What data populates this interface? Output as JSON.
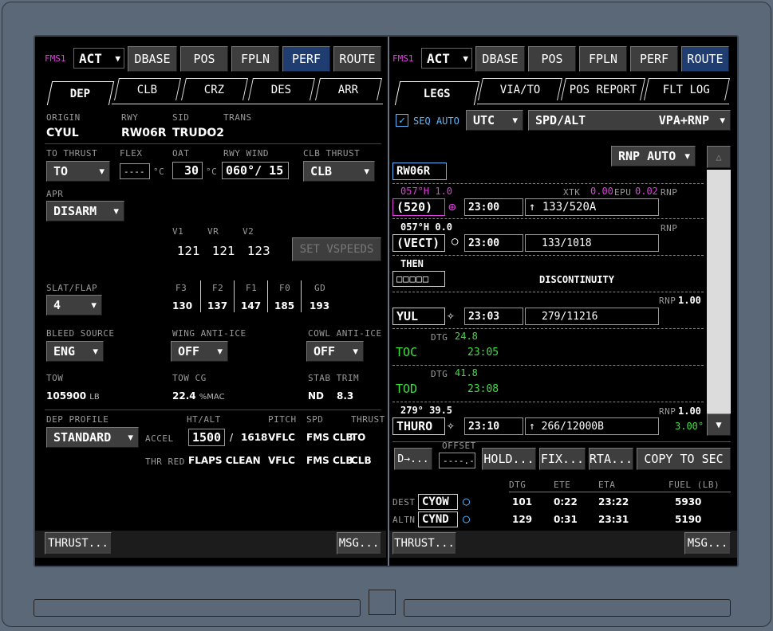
{
  "left": {
    "fms": "FMS1",
    "act": "ACT",
    "tabs_top": [
      "DBASE",
      "POS",
      "FPLN",
      "PERF",
      "ROUTE"
    ],
    "subtabs": [
      "DEP",
      "CLB",
      "CRZ",
      "DES",
      "ARR"
    ],
    "origin_lbl": "ORIGIN",
    "origin": "CYUL",
    "rwy_lbl": "RWY",
    "rwy": "RW06R",
    "sid_lbl": "SID",
    "sid": "TRUDO2",
    "trans_lbl": "TRANS",
    "to_thrust_lbl": "TO THRUST",
    "to_thrust": "TO",
    "flex_lbl": "FLEX",
    "flex": "----",
    "flex_unit": "°C",
    "oat_lbl": "OAT",
    "oat": "30",
    "oat_unit": "°C",
    "rwy_wind_lbl": "RWY WIND",
    "rwy_wind": "060°/ 15",
    "clb_thrust_lbl": "CLB THRUST",
    "clb_thrust": "CLB",
    "apr_lbl": "APR",
    "apr": "DISARM",
    "v1_lbl": "V1",
    "vr_lbl": "VR",
    "v2_lbl": "V2",
    "v1": "121",
    "vr": "121",
    "v2": "123",
    "set_vspeeds": "SET VSPEEDS",
    "slat_flap_lbl": "SLAT/FLAP",
    "slat_flap": "4",
    "f3_lbl": "F3",
    "f2_lbl": "F2",
    "f1_lbl": "F1",
    "f0_lbl": "F0",
    "gd_lbl": "GD",
    "f3": "130",
    "f2": "137",
    "f1": "147",
    "f0": "185",
    "gd": "193",
    "bleed_lbl": "BLEED SOURCE",
    "bleed": "ENG",
    "wing_lbl": "WING ANTI-ICE",
    "wing": "OFF",
    "cowl_lbl": "COWL ANTI-ICE",
    "cowl": "OFF",
    "tow_lbl": "TOW",
    "tow": "105900",
    "tow_unit": "LB",
    "towcg_lbl": "TOW CG",
    "towcg": "22.4",
    "towcg_unit": "%MAC",
    "stab_lbl": "STAB TRIM",
    "stab_nd": "ND",
    "stab": "8.3",
    "dep_profile_lbl": "DEP PROFILE",
    "dep_profile": "STANDARD",
    "htalt_lbl": "HT/ALT",
    "pitch_lbl": "PITCH",
    "spd_lbl": "SPD",
    "thrust_lbl": "THRUST",
    "accel_lbl": "ACCEL",
    "accel_ht": "1500",
    "accel_sep": "/",
    "accel_alt": "1618",
    "accel_pitch": "VFLC",
    "accel_spd": "FMS CLB",
    "accel_thrust": "TO",
    "thrred_lbl": "THR RED",
    "thrred_alt": "FLAPS CLEAN",
    "thrred_pitch": "VFLC",
    "thrred_spd": "FMS CLB",
    "thrred_thrust": "CLB",
    "thrust_btn": "THRUST...",
    "msg_btn": "MSG..."
  },
  "right": {
    "fms": "FMS1",
    "act": "ACT",
    "tabs_top": [
      "DBASE",
      "POS",
      "FPLN",
      "PERF",
      "ROUTE"
    ],
    "subtabs": [
      "LEGS",
      "VIA/TO",
      "POS REPORT",
      "FLT LOG"
    ],
    "seq_auto": "SEQ AUTO",
    "utc": "UTC",
    "spd_alt": "SPD/ALT",
    "vpa_rnp": "VPA+RNP",
    "rnp_auto": "RNP AUTO",
    "rwy": "RW06R",
    "leg1_hdg": "057°H 1.0",
    "leg1_xtk_lbl": "XTK",
    "leg1_xtk": "0.00",
    "leg1_epu_lbl": "EPU",
    "leg1_epu": "0.02",
    "leg1_rnp_lbl": "RNP",
    "leg1_wpt": "(520)",
    "leg1_time": "23:00",
    "leg1_arrow": "↑",
    "leg1_spdalt": "133/520A",
    "leg2_hdg": "057°H 0.0",
    "leg2_rnp_lbl": "RNP",
    "leg2_wpt": "(VECT)",
    "leg2_time": "23:00",
    "leg2_spdalt": "133/1018",
    "then": "THEN",
    "disc_box": "□□□□□",
    "discontinuity": "DISCONTINUITY",
    "leg3_rnp_lbl": "RNP",
    "leg3_rnp": "1.00",
    "leg3_wpt": "YUL",
    "leg3_time": "23:03",
    "leg3_spdalt": "279/11216",
    "leg4_dtg_lbl": "DTG",
    "leg4_dtg": "24.8",
    "leg4_wpt": "TOC",
    "leg4_time": "23:05",
    "leg5_dtg_lbl": "DTG",
    "leg5_dtg": "41.8",
    "leg5_wpt": "TOD",
    "leg5_time": "23:08",
    "leg6_hdg": "279° 39.5",
    "leg6_rnp_lbl": "RNP",
    "leg6_rnp": "1.00",
    "leg6_wpt": "THURO",
    "leg6_time": "23:10",
    "leg6_arrow": "↑",
    "leg6_spdalt": "266/12000B",
    "leg6_vpa": "3.00°",
    "direct": "D→...",
    "offset_lbl": "OFFSET",
    "offset": "----.-",
    "hold": "HOLD...",
    "fix": "FIX...",
    "rta": "RTA...",
    "copy": "COPY TO SEC",
    "dtg_lbl": "DTG",
    "ete_lbl": "ETE",
    "eta_lbl": "ETA",
    "fuel_lbl": "FUEL (LB)",
    "dest_lbl": "DEST",
    "dest": "CYOW",
    "dest_dtg": "101",
    "dest_ete": "0:22",
    "dest_eta": "23:22",
    "dest_fuel": "5930",
    "altn_lbl": "ALTN",
    "altn": "CYND",
    "altn_dtg": "129",
    "altn_ete": "0:31",
    "altn_eta": "23:31",
    "altn_fuel": "5190",
    "thrust_btn": "THRUST...",
    "msg_btn": "MSG..."
  },
  "colors": {
    "selected": "#1f3d70",
    "magenta": "#e040e0",
    "green": "#3ee03e",
    "cyan": "#5ab8ff"
  }
}
